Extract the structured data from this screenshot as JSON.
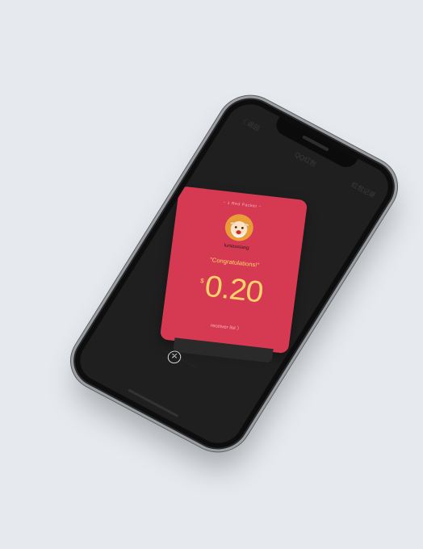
{
  "header": {
    "back_label": "〈 返回",
    "title": "QQ红包",
    "record_label": "红包记录"
  },
  "card": {
    "subtitle": "~ 1 Red Packet ~",
    "username": "luniaoxiang",
    "greeting": "\"Congratulations!\"",
    "currency": "$",
    "amount": "0.20",
    "link": "receiver list 〉"
  },
  "close_icon": "✕",
  "bottom_hint": "————————",
  "colors": {
    "background": "#e6eaee",
    "card": "#d63a52",
    "amount": "#ffd36b"
  }
}
